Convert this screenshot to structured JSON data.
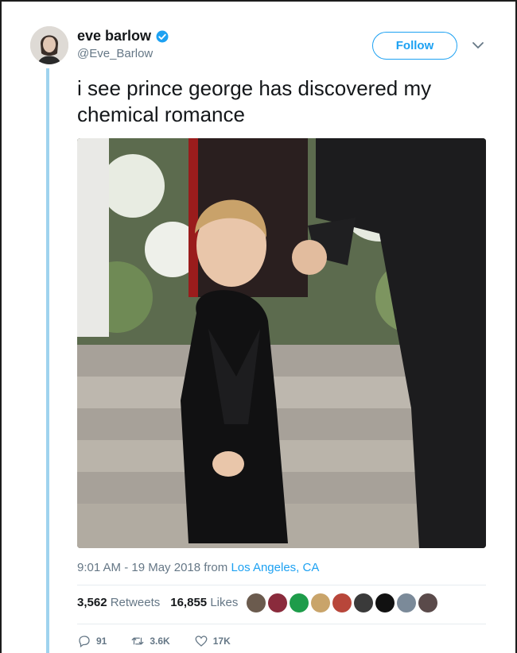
{
  "tweet": {
    "author": {
      "display_name": "eve barlow",
      "handle": "@Eve_Barlow",
      "verified": true
    },
    "follow_label": "Follow",
    "text": "i see prince george has discovered my chemical romance",
    "timestamp": "9:01 AM - 19 May 2018",
    "from_label": "from",
    "location": "Los Angeles, CA",
    "stats": {
      "retweets_count": "3,562",
      "retweets_label": "Retweets",
      "likes_count": "16,855",
      "likes_label": "Likes"
    },
    "liker_avatars": [
      "#6b5b4e",
      "#8a2b3c",
      "#1e9c4a",
      "#c9a46a",
      "#b8463a",
      "#3a3a3a",
      "#111111",
      "#7b8a99",
      "#5a4a4a"
    ],
    "actions": {
      "reply_count": "91",
      "retweet_count": "3.6K",
      "like_count": "17K"
    }
  },
  "colors": {
    "accent": "#1da1f2",
    "muted": "#657786",
    "text": "#14171a",
    "thread_line": "#9fd3ee"
  },
  "icons": [
    "verified-badge-icon",
    "chevron-down-icon",
    "reply-icon",
    "retweet-icon",
    "heart-icon"
  ]
}
